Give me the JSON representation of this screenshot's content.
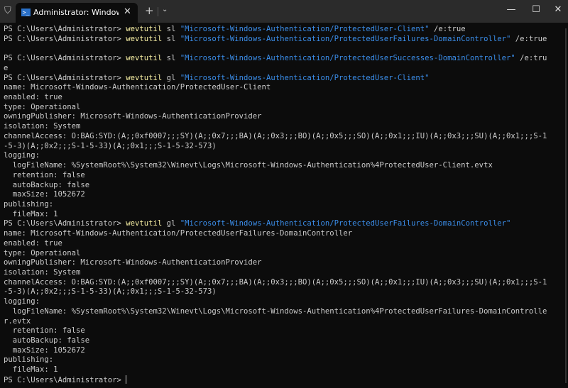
{
  "window": {
    "tab_title": "Administrator: Windows PowerShell",
    "new_tab": "+",
    "dropdown": "⌄",
    "minimize": "—",
    "maximize": "☐",
    "close": "✕",
    "tab_close": "✕"
  },
  "colors": {
    "prompt": "#cccccc",
    "command": "#f9f1a5",
    "string": "#3b8eea",
    "background": "#0c0c0c"
  },
  "terminal": {
    "lines": [
      [
        [
          "p",
          "PS C:\\Users\\Administrator> "
        ],
        [
          "c",
          "wevtutil"
        ],
        [
          "p",
          " sl "
        ],
        [
          "s",
          "\"Microsoft-Windows-Authentication/ProtectedUser-Client\""
        ],
        [
          "p",
          " /e:true"
        ]
      ],
      [
        [
          "p",
          "PS C:\\Users\\Administrator> "
        ],
        [
          "c",
          "wevtutil"
        ],
        [
          "p",
          " sl "
        ],
        [
          "s",
          "\"Microsoft-Windows-Authentication/ProtectedUserFailures-DomainController\""
        ],
        [
          "p",
          " /e:true"
        ]
      ],
      [],
      [
        [
          "p",
          "PS C:\\Users\\Administrator> "
        ],
        [
          "c",
          "wevtutil"
        ],
        [
          "p",
          " sl "
        ],
        [
          "s",
          "\"Microsoft-Windows-Authentication/ProtectedUserSuccesses-DomainController\""
        ],
        [
          "p",
          " /e:tru"
        ]
      ],
      [
        [
          "p",
          "e"
        ]
      ],
      [
        [
          "p",
          "PS C:\\Users\\Administrator> "
        ],
        [
          "c",
          "wevtutil"
        ],
        [
          "p",
          " gl "
        ],
        [
          "s",
          "\"Microsoft-Windows-Authentication/ProtectedUser-Client\""
        ]
      ],
      [
        [
          "p",
          "name: Microsoft-Windows-Authentication/ProtectedUser-Client"
        ]
      ],
      [
        [
          "p",
          "enabled: true"
        ]
      ],
      [
        [
          "p",
          "type: Operational"
        ]
      ],
      [
        [
          "p",
          "owningPublisher: Microsoft-Windows-AuthenticationProvider"
        ]
      ],
      [
        [
          "p",
          "isolation: System"
        ]
      ],
      [
        [
          "p",
          "channelAccess: O:BAG:SYD:(A;;0xf0007;;;SY)(A;;0x7;;;BA)(A;;0x3;;;BO)(A;;0x5;;;SO)(A;;0x1;;;IU)(A;;0x3;;;SU)(A;;0x1;;;S-1"
        ]
      ],
      [
        [
          "p",
          "-5-3)(A;;0x2;;;S-1-5-33)(A;;0x1;;;S-1-5-32-573)"
        ]
      ],
      [
        [
          "p",
          "logging:"
        ]
      ],
      [
        [
          "p",
          "  logFileName: %SystemRoot%\\System32\\Winevt\\Logs\\Microsoft-Windows-Authentication%4ProtectedUser-Client.evtx"
        ]
      ],
      [
        [
          "p",
          "  retention: false"
        ]
      ],
      [
        [
          "p",
          "  autoBackup: false"
        ]
      ],
      [
        [
          "p",
          "  maxSize: 1052672"
        ]
      ],
      [
        [
          "p",
          "publishing:"
        ]
      ],
      [
        [
          "p",
          "  fileMax: 1"
        ]
      ],
      [
        [
          "p",
          "PS C:\\Users\\Administrator> "
        ],
        [
          "c",
          "wevtutil"
        ],
        [
          "p",
          " gl "
        ],
        [
          "s",
          "\"Microsoft-Windows-Authentication/ProtectedUserFailures-DomainController\""
        ]
      ],
      [
        [
          "p",
          "name: Microsoft-Windows-Authentication/ProtectedUserFailures-DomainController"
        ]
      ],
      [
        [
          "p",
          "enabled: true"
        ]
      ],
      [
        [
          "p",
          "type: Operational"
        ]
      ],
      [
        [
          "p",
          "owningPublisher: Microsoft-Windows-AuthenticationProvider"
        ]
      ],
      [
        [
          "p",
          "isolation: System"
        ]
      ],
      [
        [
          "p",
          "channelAccess: O:BAG:SYD:(A;;0xf0007;;;SY)(A;;0x7;;;BA)(A;;0x3;;;BO)(A;;0x5;;;SO)(A;;0x1;;;IU)(A;;0x3;;;SU)(A;;0x1;;;S-1"
        ]
      ],
      [
        [
          "p",
          "-5-3)(A;;0x2;;;S-1-5-33)(A;;0x1;;;S-1-5-32-573)"
        ]
      ],
      [
        [
          "p",
          "logging:"
        ]
      ],
      [
        [
          "p",
          "  logFileName: %SystemRoot%\\System32\\Winevt\\Logs\\Microsoft-Windows-Authentication%4ProtectedUserFailures-DomainControlle"
        ]
      ],
      [
        [
          "p",
          "r.evtx"
        ]
      ],
      [
        [
          "p",
          "  retention: false"
        ]
      ],
      [
        [
          "p",
          "  autoBackup: false"
        ]
      ],
      [
        [
          "p",
          "  maxSize: 1052672"
        ]
      ],
      [
        [
          "p",
          "publishing:"
        ]
      ],
      [
        [
          "p",
          "  fileMax: 1"
        ]
      ],
      [
        [
          "p",
          "PS C:\\Users\\Administrator> "
        ]
      ]
    ]
  }
}
